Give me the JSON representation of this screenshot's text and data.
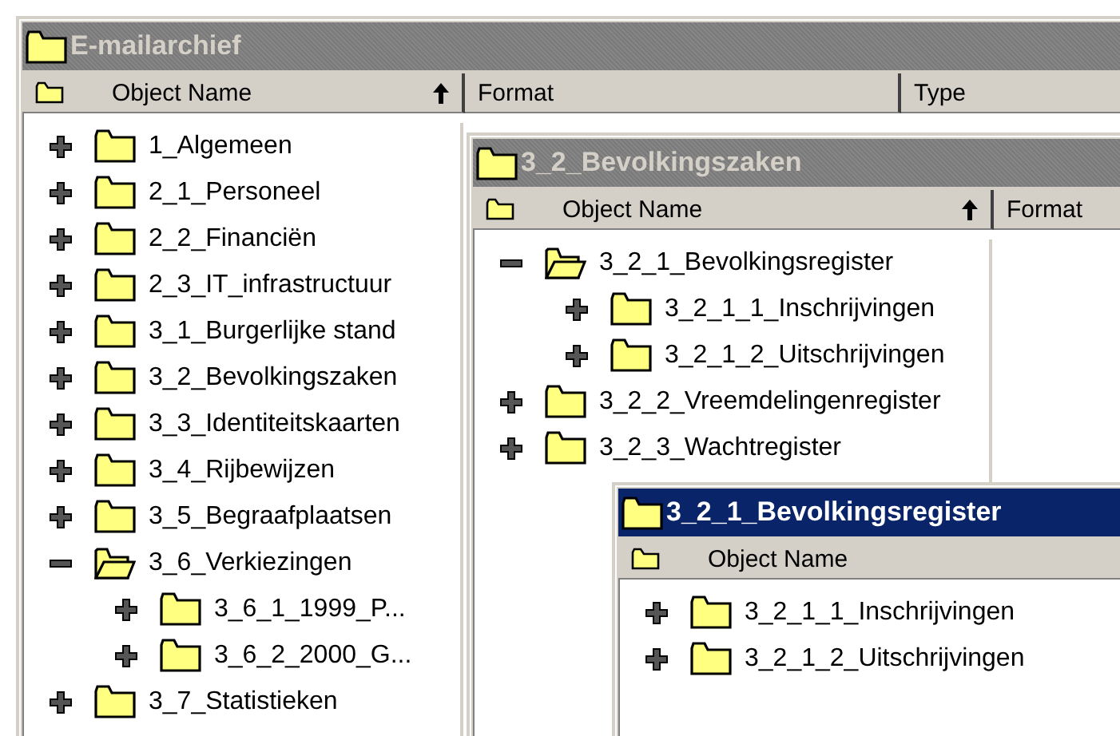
{
  "windows": [
    {
      "title": "E-mailarchief",
      "active": false,
      "columns": [
        {
          "label": "Object Name",
          "sorted": true
        },
        {
          "label": "Format"
        },
        {
          "label": "Type"
        }
      ],
      "tree": [
        {
          "label": "1_Algemeen",
          "expanded": false
        },
        {
          "label": "2_1_Personeel",
          "expanded": false
        },
        {
          "label": "2_2_Financiën",
          "expanded": false
        },
        {
          "label": "2_3_IT_infrastructuur",
          "expanded": false
        },
        {
          "label": "3_1_Burgerlijke stand",
          "expanded": false
        },
        {
          "label": "3_2_Bevolkingszaken",
          "expanded": false
        },
        {
          "label": "3_3_Identiteitskaarten",
          "expanded": false
        },
        {
          "label": "3_4_Rijbewijzen",
          "expanded": false
        },
        {
          "label": "3_5_Begraafplaatsen",
          "expanded": false
        },
        {
          "label": "3_6_Verkiezingen",
          "expanded": true,
          "children": [
            {
              "label": "3_6_1_1999_P...",
              "expanded": false
            },
            {
              "label": "3_6_2_2000_G...",
              "expanded": false
            }
          ]
        },
        {
          "label": "3_7_Statistieken",
          "expanded": false
        }
      ]
    },
    {
      "title": "3_2_Bevolkingszaken",
      "active": false,
      "columns": [
        {
          "label": "Object Name",
          "sorted": true
        },
        {
          "label": "Format"
        }
      ],
      "tree": [
        {
          "label": "3_2_1_Bevolkingsregister",
          "expanded": true,
          "children": [
            {
              "label": "3_2_1_1_Inschrijvingen",
              "expanded": false
            },
            {
              "label": "3_2_1_2_Uitschrijvingen",
              "expanded": false
            }
          ]
        },
        {
          "label": "3_2_2_Vreemdelingenregister",
          "expanded": false
        },
        {
          "label": "3_2_3_Wachtregister",
          "expanded": false
        }
      ]
    },
    {
      "title": "3_2_1_Bevolkingsregister",
      "active": true,
      "columns": [
        {
          "label": "Object Name"
        }
      ],
      "tree": [
        {
          "label": "3_2_1_1_Inschrijvingen",
          "expanded": false
        },
        {
          "label": "3_2_1_2_Uitschrijvingen",
          "expanded": false
        }
      ]
    }
  ]
}
